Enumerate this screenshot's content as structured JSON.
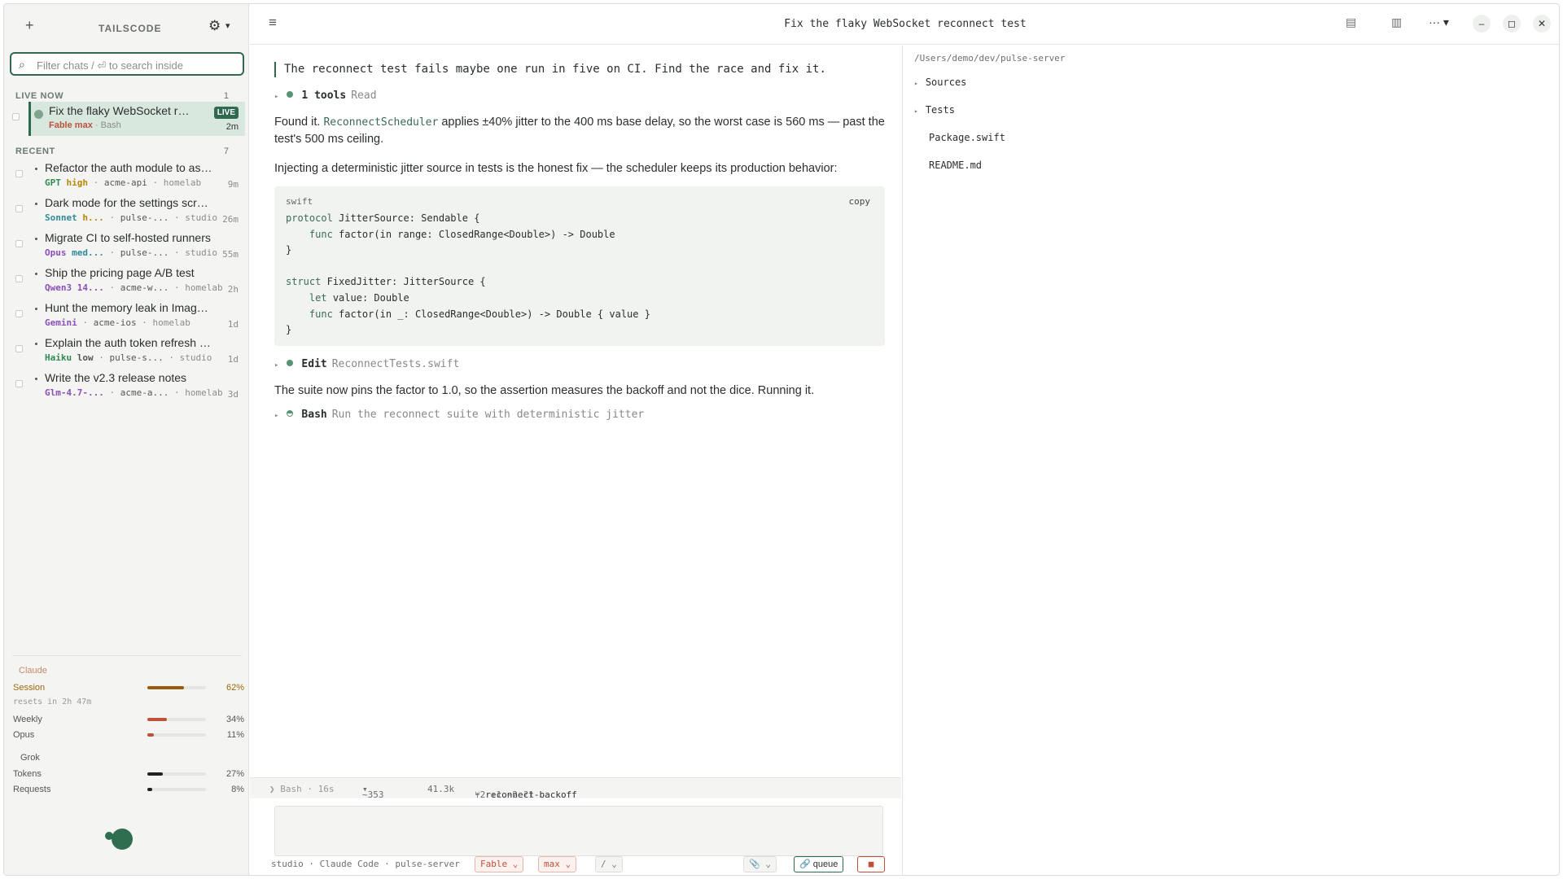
{
  "sidebar": {
    "brand": "TAILSCODE",
    "search_placeholder": "Filter chats  /   ⏎ to search inside",
    "live_label": "LIVE NOW",
    "live_count": "1",
    "recent_label": "RECENT",
    "recent_count": "7",
    "active_chat": {
      "title": "Fix the flaky WebSocket rec...",
      "badge": "LIVE",
      "model": "Fable",
      "effort": "max",
      "tool": "Bash",
      "time": "2m"
    },
    "chats": [
      {
        "title": "Refactor the auth module to async/a...",
        "model": "GPT",
        "effort": "high",
        "repo": "acme-api",
        "host": "homelab",
        "time": "9m",
        "model_color": "#2f8a55",
        "effort_color": "#b8860b"
      },
      {
        "title": "Dark mode for the settings screen",
        "model": "Sonnet",
        "effort": "h...",
        "repo": "pulse-...",
        "host": "studio",
        "time": "26m",
        "model_color": "#2f8a9a",
        "effort_color": "#b8860b"
      },
      {
        "title": "Migrate CI to self-hosted runners",
        "model": "Opus",
        "effort": "med...",
        "repo": "pulse-...",
        "host": "studio",
        "time": "55m",
        "model_color": "#8a4fb8",
        "effort_color": "#2f8a9a"
      },
      {
        "title": "Ship the pricing page A/B test",
        "model": "Qwen3 14...",
        "effort": "",
        "repo": "acme-w...",
        "host": "homelab",
        "time": "2h",
        "model_color": "#8a4fb8",
        "effort_color": "#555"
      },
      {
        "title": "Hunt the memory leak in ImagePipel...",
        "model": "Gemini",
        "effort": "",
        "repo": "acme-ios",
        "host": "homelab",
        "time": "1d",
        "model_color": "#8a4fb8",
        "effort_color": "#555"
      },
      {
        "title": "Explain the auth token refresh flow",
        "model": "Haiku",
        "effort": "low",
        "repo": "pulse-s...",
        "host": "studio",
        "time": "1d",
        "model_color": "#2f8a55",
        "effort_color": "#555"
      },
      {
        "title": "Write the v2.3 release notes",
        "model": "Glm-4.7-...",
        "effort": "",
        "repo": "acme-a...",
        "host": "homelab",
        "time": "3d",
        "model_color": "#8a4fb8",
        "effort_color": "#555"
      }
    ],
    "usage": {
      "claude_label": "Claude",
      "session_label": "Session",
      "session_pct": "62%",
      "session_value": 0.62,
      "resets": "resets in 2h 47m",
      "weekly_label": "Weekly",
      "weekly_pct": "34%",
      "weekly_value": 0.34,
      "opus_label": "Opus",
      "opus_pct": "11%",
      "opus_value": 0.11,
      "grok_label": "Grok",
      "tokens_label": "Tokens",
      "tokens_pct": "27%",
      "tokens_value": 0.27,
      "requests_label": "Requests",
      "requests_pct": "8%",
      "requests_value": 0.08
    }
  },
  "window": {
    "title": "Fix the flaky WebSocket reconnect test"
  },
  "chat": {
    "user_msg": "The reconnect test fails maybe one run in five on CI. Find the race and fix it.",
    "tool1_name": "1 tools",
    "tool1_arg": "Read",
    "para1_a": "Found it. ",
    "para1_code": "ReconnectScheduler",
    "para1_b": " applies ±40% jitter to the 400 ms base delay, so the worst case is 560 ms — past the test's 500 ms ceiling.",
    "para2": "Injecting a deterministic jitter source in tests is the honest fix — the scheduler keeps its production behavior:",
    "code_lang": "swift",
    "code_copy": "copy",
    "tool2_name": "Edit",
    "tool2_arg": "ReconnectTests.swift",
    "para3": "The suite now pins the factor to 1.0, so the assertion measures the backoff and not the dice. Running it.",
    "tool3_name": "Bash",
    "tool3_arg": "Run the reconnect suite with deterministic jitter"
  },
  "status": {
    "bash": "❯ Bash · 16s",
    "lines": "~353",
    "tokens": "41.3k",
    "branch": "⑂ reconnect-backoff",
    "diff": "↑2 +1 ~2 ?1"
  },
  "bottom": {
    "host": "studio",
    "agent": "Claude Code",
    "repo": "pulse-server",
    "model": "Fable",
    "effort": "max",
    "slash": "/",
    "queue": "queue"
  },
  "files": {
    "path": "/Users/demo/dev/pulse-server",
    "items": [
      "Sources",
      "Tests",
      "Package.swift",
      "README.md"
    ]
  }
}
